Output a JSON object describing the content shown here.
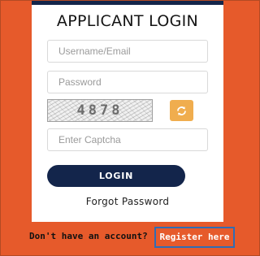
{
  "login": {
    "title": "APPLICANT LOGIN",
    "username_placeholder": "Username/Email",
    "password_placeholder": "Password",
    "captcha_text": "4878",
    "captcha_placeholder": "Enter Captcha",
    "login_label": "LOGIN",
    "forgot_label": "Forgot Password"
  },
  "footer": {
    "prompt": "Don't have an account?",
    "register_label": "Register here"
  },
  "colors": {
    "background": "#e65a2b",
    "navy": "#13254b",
    "refresh_button": "#f0ad4e",
    "highlight_border": "#2f6db5"
  },
  "icons": {
    "refresh": "refresh-icon"
  }
}
